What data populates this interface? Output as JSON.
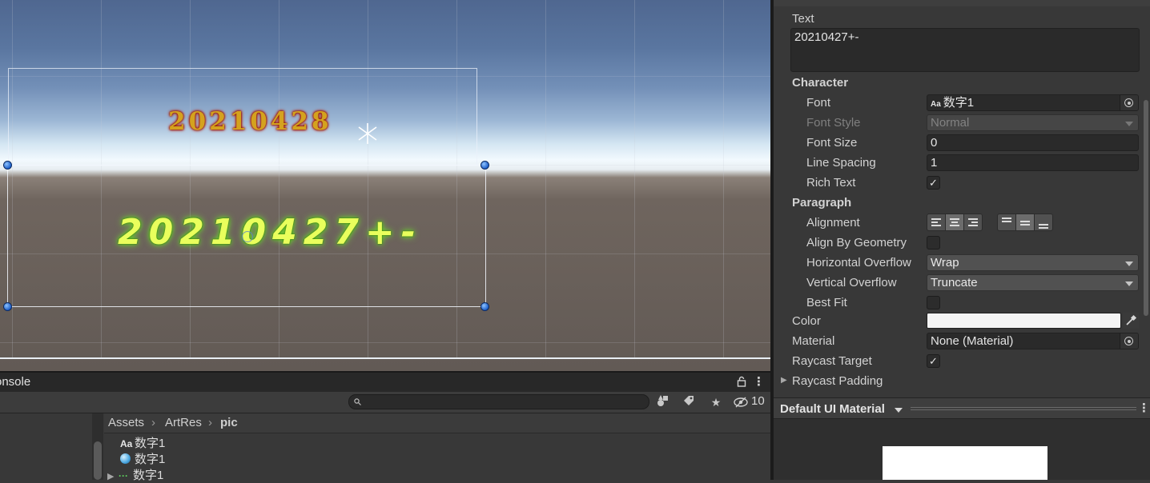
{
  "scene": {
    "text_red": "20210428",
    "text_green": "20210427+-"
  },
  "bottom": {
    "tab_label": "onsole",
    "hidden_count": "10",
    "breadcrumb": [
      "Assets",
      "ArtRes",
      "pic"
    ],
    "assets": [
      {
        "icon": "font-icon",
        "glyph": "Aa",
        "name": "数字1"
      },
      {
        "icon": "sphere-icon",
        "glyph": "",
        "name": "数字1"
      },
      {
        "icon": "prefab-icon",
        "glyph": "",
        "name": "数字1"
      }
    ]
  },
  "inspector": {
    "text_label": "Text",
    "text_value": "20210427+-",
    "character_header": "Character",
    "font_label": "Font",
    "font_value": "数字1",
    "font_value_icon": "Aa",
    "font_style_label": "Font Style",
    "font_style_value": "Normal",
    "font_size_label": "Font Size",
    "font_size_value": "0",
    "line_spacing_label": "Line Spacing",
    "line_spacing_value": "1",
    "rich_text_label": "Rich Text",
    "rich_text_checked": true,
    "paragraph_header": "Paragraph",
    "alignment_label": "Alignment",
    "align_by_geometry_label": "Align By Geometry",
    "horizontal_overflow_label": "Horizontal Overflow",
    "horizontal_overflow_value": "Wrap",
    "vertical_overflow_label": "Vertical Overflow",
    "vertical_overflow_value": "Truncate",
    "best_fit_label": "Best Fit",
    "color_label": "Color",
    "color_value": "#f4f4f4",
    "material_label": "Material",
    "material_value": "None (Material)",
    "raycast_target_label": "Raycast Target",
    "raycast_padding_label": "Raycast Padding",
    "check_glyph": "✓",
    "material_section_title": "Default UI Material"
  }
}
